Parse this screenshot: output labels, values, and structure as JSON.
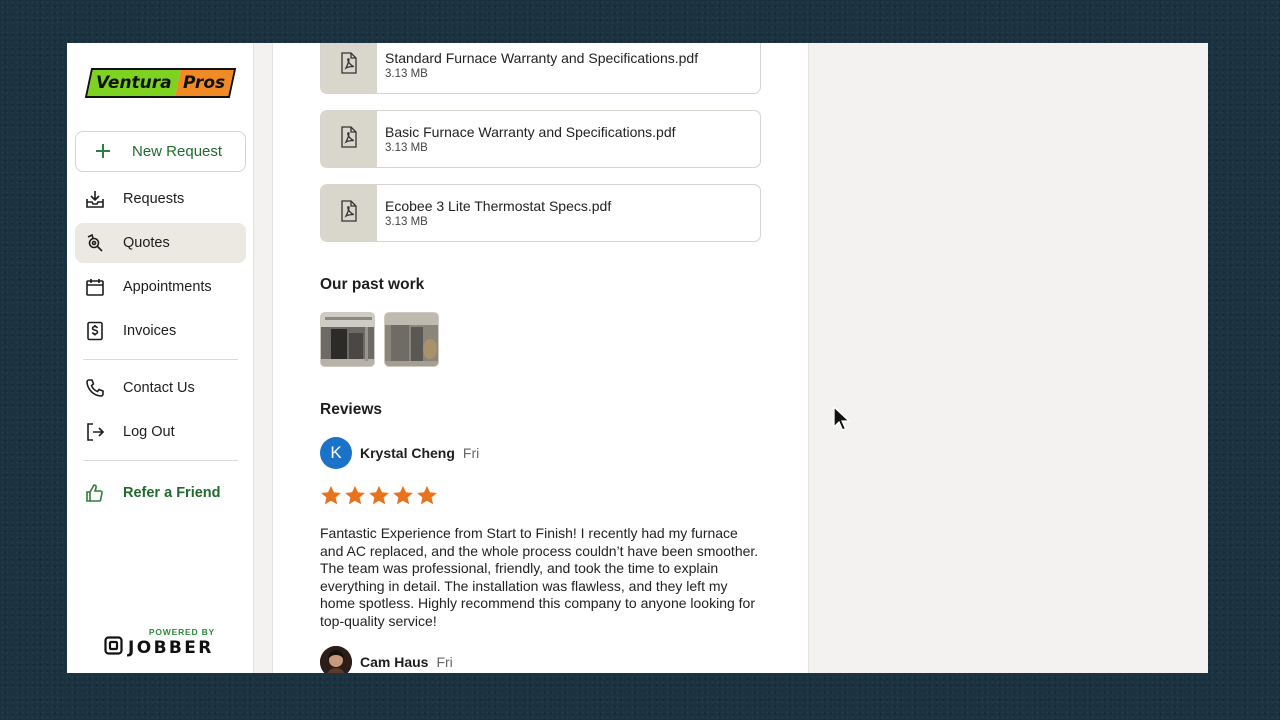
{
  "brand": {
    "logo_left": "Ventura",
    "logo_right": "Pros",
    "logo_colors": {
      "left": "#7ed321",
      "right": "#f08a24"
    }
  },
  "sidebar": {
    "new_request_label": "New Request",
    "items": [
      {
        "label": "Requests",
        "icon": "inbox-download-icon",
        "active": false
      },
      {
        "label": "Quotes",
        "icon": "quote-search-icon",
        "active": true
      },
      {
        "label": "Appointments",
        "icon": "calendar-icon",
        "active": false
      },
      {
        "label": "Invoices",
        "icon": "invoice-dollar-icon",
        "active": false
      },
      {
        "label": "Contact Us",
        "icon": "phone-icon",
        "active": false
      },
      {
        "label": "Log Out",
        "icon": "logout-icon",
        "active": false
      },
      {
        "label": "Refer a Friend",
        "icon": "thumbs-up-icon",
        "active": false
      }
    ],
    "powered_by": "POWERED BY",
    "powered_brand": "JOBBER"
  },
  "files": [
    {
      "name": "Standard Furnace Warranty and Specifications.pdf",
      "size": "3.13 MB",
      "icon": "pdf-icon"
    },
    {
      "name": "Basic Furnace Warranty and Specifications.pdf",
      "size": "3.13 MB",
      "icon": "pdf-icon"
    },
    {
      "name": "Ecobee 3 Lite Thermostat Specs.pdf",
      "size": "3.13 MB",
      "icon": "pdf-icon"
    }
  ],
  "past_work": {
    "title": "Our past work",
    "photos": [
      "furnace-install-photo-1",
      "furnace-install-photo-2"
    ]
  },
  "reviews": {
    "title": "Reviews",
    "items": [
      {
        "avatar_letter": "K",
        "name": "Krystal Cheng",
        "date": "Fri",
        "rating": 5,
        "text": "Fantastic Experience from Start to Finish! I recently had my furnace and AC replaced, and the whole process couldn’t have been smoother. The team was professional, friendly, and took the time to explain everything in detail. The installation was flawless, and they left my home spotless. Highly recommend this company to anyone looking for top-quality service!"
      },
      {
        "name": "Cam Haus",
        "date": "Fri"
      }
    ]
  },
  "colors": {
    "accent_green": "#1f6b2c",
    "star_orange": "#e8731e",
    "avatar_blue": "#1a73c8",
    "active_nav_bg": "#ebe9e1"
  }
}
